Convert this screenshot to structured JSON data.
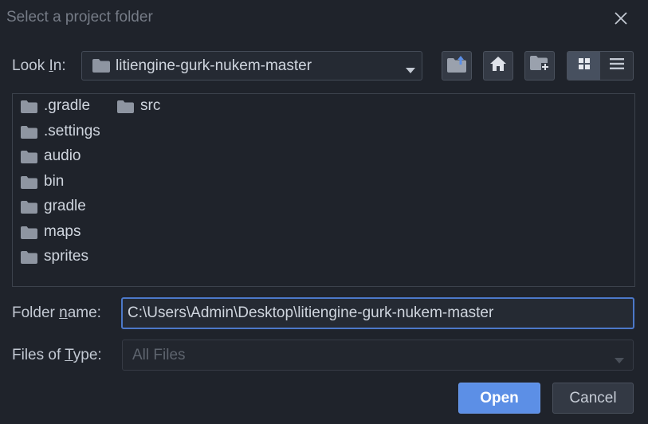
{
  "dialog": {
    "title": "Select a project folder"
  },
  "look_in": {
    "label_pre": "Look ",
    "label_mnemonic": "I",
    "label_post": "n:",
    "value": "litiengine-gurk-nukem-master"
  },
  "toolbar": {
    "icons": [
      "folder-up-icon",
      "home-icon",
      "new-folder-icon",
      "grid-view-icon",
      "list-view-icon"
    ]
  },
  "files": [
    {
      "name": ".gradle"
    },
    {
      "name": ".settings"
    },
    {
      "name": "audio"
    },
    {
      "name": "bin"
    },
    {
      "name": "gradle"
    },
    {
      "name": "maps"
    },
    {
      "name": "sprites"
    },
    {
      "name": "src"
    }
  ],
  "folder_name": {
    "label_pre": "Folder ",
    "label_mnemonic": "n",
    "label_post": "ame:",
    "value": "C:\\Users\\Admin\\Desktop\\litiengine-gurk-nukem-master"
  },
  "file_type": {
    "label_pre": "Files of ",
    "label_mnemonic": "T",
    "label_post": "ype:",
    "value": "All Files"
  },
  "buttons": {
    "open": "Open",
    "cancel": "Cancel"
  },
  "colors": {
    "background": "#1f232b",
    "accent": "#5c8fe6",
    "folder_icon": "#8e95a1"
  }
}
